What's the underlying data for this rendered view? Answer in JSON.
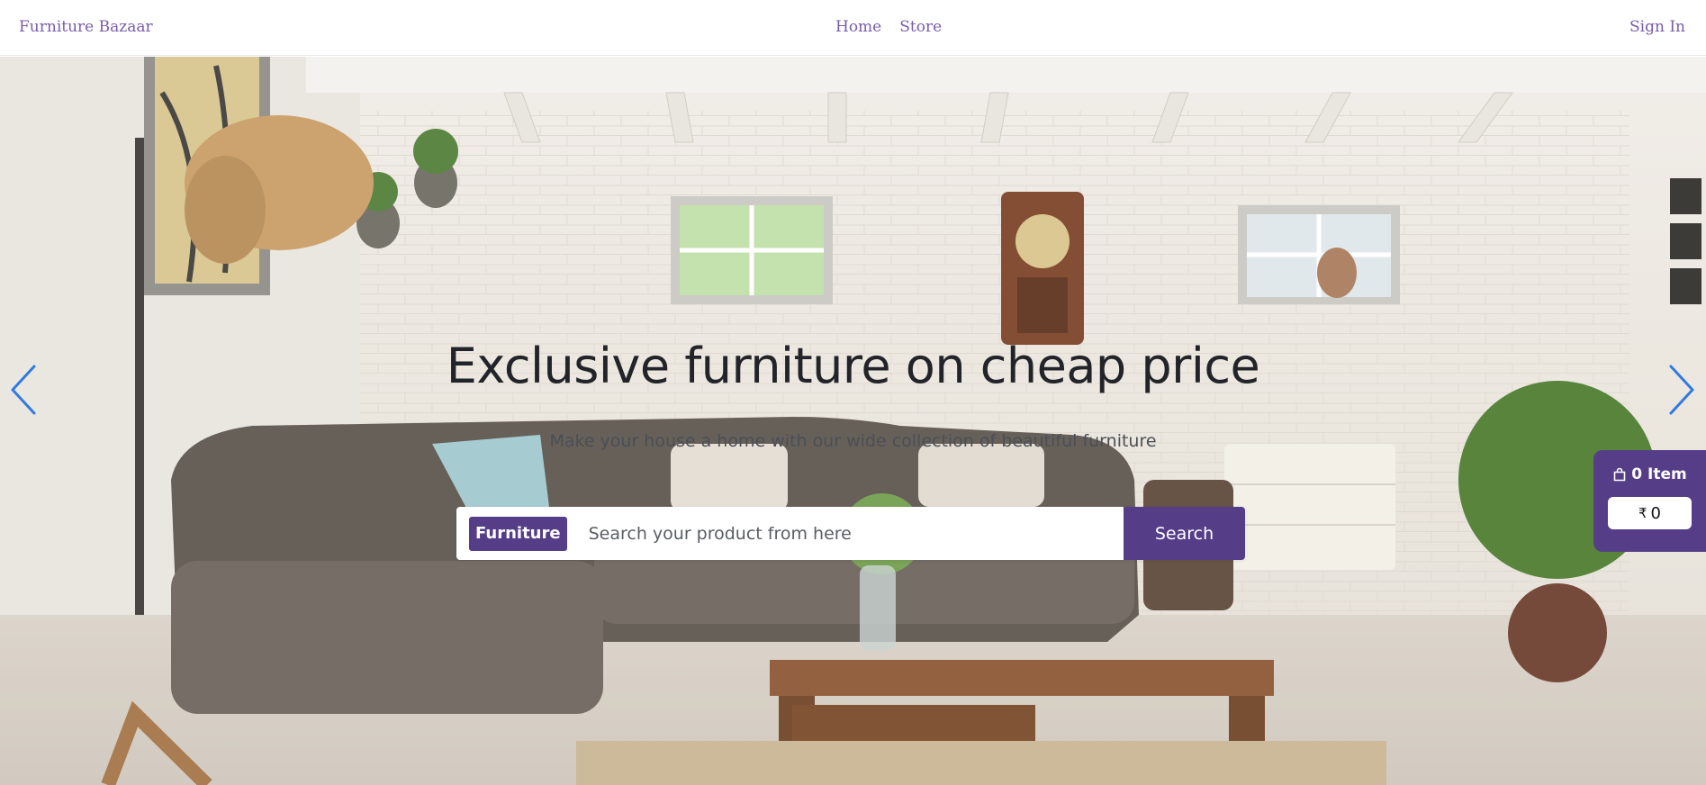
{
  "navbar": {
    "brand": "Furniture Bazaar",
    "links": [
      "Home",
      "Store"
    ],
    "signin": "Sign In"
  },
  "hero": {
    "title": "Exclusive furniture on cheap price",
    "subtitle": "Make your house a home with our wide collection of beautiful furniture",
    "background_icon": "living-room-photo"
  },
  "search": {
    "category": "Furniture",
    "placeholder": "Search your product from here",
    "value": "",
    "button_label": "Search"
  },
  "carousel": {
    "prev_icon": "chevron-left-icon",
    "next_icon": "chevron-right-icon"
  },
  "cart": {
    "icon": "shopping-bag-icon",
    "items_label": "0 Item",
    "currency": "₹",
    "total": "0"
  },
  "colors": {
    "brand": "#7a5ca9",
    "accent": "#563d87",
    "arrow": "#2f7ae5"
  }
}
